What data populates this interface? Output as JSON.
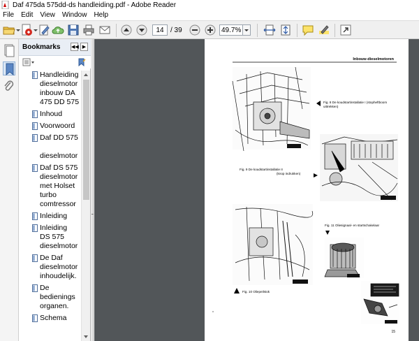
{
  "window": {
    "title": "Daf 475da 575dd-ds handleiding.pdf - Adobe Reader"
  },
  "menu": {
    "items": [
      "File",
      "Edit",
      "View",
      "Window",
      "Help"
    ]
  },
  "toolbar": {
    "current_page": "14",
    "total_pages": "/ 39",
    "zoom": "49.7%"
  },
  "bookmarks": {
    "title": "Bookmarks",
    "items": [
      {
        "label": "Handleiding\ndieselmotor\ninbouw DA\n475 DD 575"
      },
      {
        "label": "Inhoud"
      },
      {
        "label": "Voorwoord"
      },
      {
        "label": "Daf DD 575\n\ndieselmotor"
      },
      {
        "label": "Daf DS 575\ndieselmotor\nmet Holset\nturbo\ncomtressor"
      },
      {
        "label": "Inleiding"
      },
      {
        "label": "Inleiding\nDS 575\ndieselmotor"
      },
      {
        "label": "De Daf\ndieselmotor\ninhoudelijk."
      },
      {
        "label": "De\nbedienings\norganen."
      },
      {
        "label": "Schema"
      }
    ]
  },
  "pdf_page": {
    "header": "Inbouw-dieselmotoren",
    "fig8_caption": "Fig. 8   De koudstartinstallatie I (stopheftboom\nuittrekken)",
    "fig9_caption": "Fig. 9   De koudstartinstallatie II\n(knop indrukken)",
    "fig10_caption": "Fig. 10   Oliepeilstok",
    "fig11_caption": "Fig. 11   Oliesignaal- en startschakelaar",
    "page_number": "15"
  }
}
